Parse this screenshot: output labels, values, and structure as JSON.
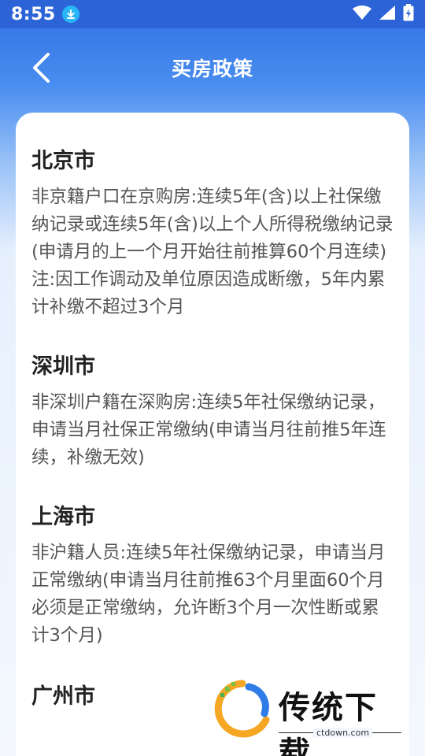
{
  "status_bar": {
    "time": "8:55",
    "icons": [
      "download-icon",
      "wifi-icon",
      "signal-icon",
      "battery-charging-icon"
    ]
  },
  "nav": {
    "title": "买房政策",
    "back_icon": "chevron-left-icon"
  },
  "sections": [
    {
      "city": "北京市",
      "policy": "非京籍户口在京购房:连续5年(含)以上社保缴纳记录或连续5年(含)以上个人所得税缴纳记录(申请月的上一个月开始往前推算60个月连续)注:因工作调动及单位原因造成断缴，5年内累计补缴不超过3个月"
    },
    {
      "city": "深圳市",
      "policy": "非深圳户籍在深购房:连续5年社保缴纳记录，申请当月社保正常缴纳(申请当月往前推5年连续，补缴无效)"
    },
    {
      "city": "上海市",
      "policy": "非沪籍人员:连续5年社保缴纳记录，申请当月正常缴纳(申请当月往前推63个月里面60个月必须是正常缴纳，允许断3个月一次性断或累计3个月)"
    },
    {
      "city": "广州市",
      "policy": ""
    }
  ],
  "watermark": {
    "brand": "传统下载",
    "url": "ctdown.com"
  },
  "colors": {
    "primary": "#2c64d8",
    "card": "#ffffff",
    "city_text": "#222222",
    "body_text": "#555555"
  }
}
